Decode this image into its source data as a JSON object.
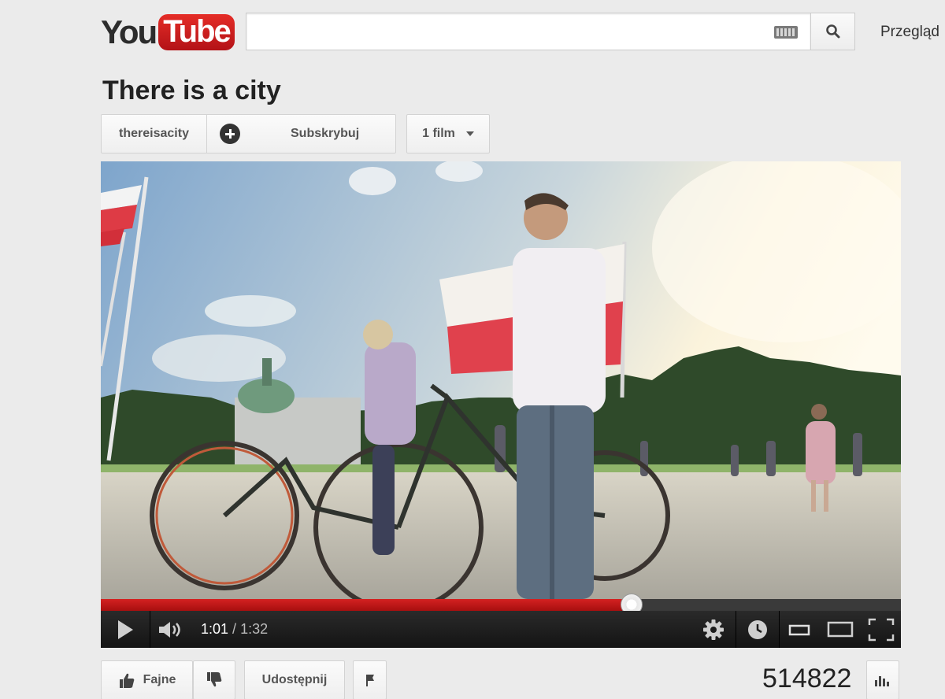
{
  "header": {
    "logo_you": "You",
    "logo_tube": "Tube",
    "search": {
      "value": "",
      "placeholder": ""
    },
    "browse_label": "Przegląd"
  },
  "channel": {
    "title": "There is a city",
    "name_button": "thereisacity",
    "subscribe_label": "Subskrybuj",
    "videos_button": "1 film"
  },
  "player": {
    "current_time": "1:01",
    "separator": " / ",
    "duration": "1:32",
    "progress_fraction": 0.663
  },
  "actions": {
    "like_label": "Fajne",
    "share_label": "Udostępnij",
    "view_count": "514822"
  },
  "icons": [
    "search-icon",
    "keyboard-icon",
    "plus-icon",
    "caret-down-icon",
    "play-icon",
    "volume-icon",
    "gear-icon",
    "clock-icon",
    "small-player-icon",
    "large-player-icon",
    "fullscreen-icon",
    "thumbs-up-icon",
    "thumbs-down-icon",
    "flag-icon",
    "stats-icon"
  ],
  "colors": {
    "brand_red": "#cc181e",
    "progress_red": "#c41717",
    "page_bg": "#ebebeb"
  }
}
